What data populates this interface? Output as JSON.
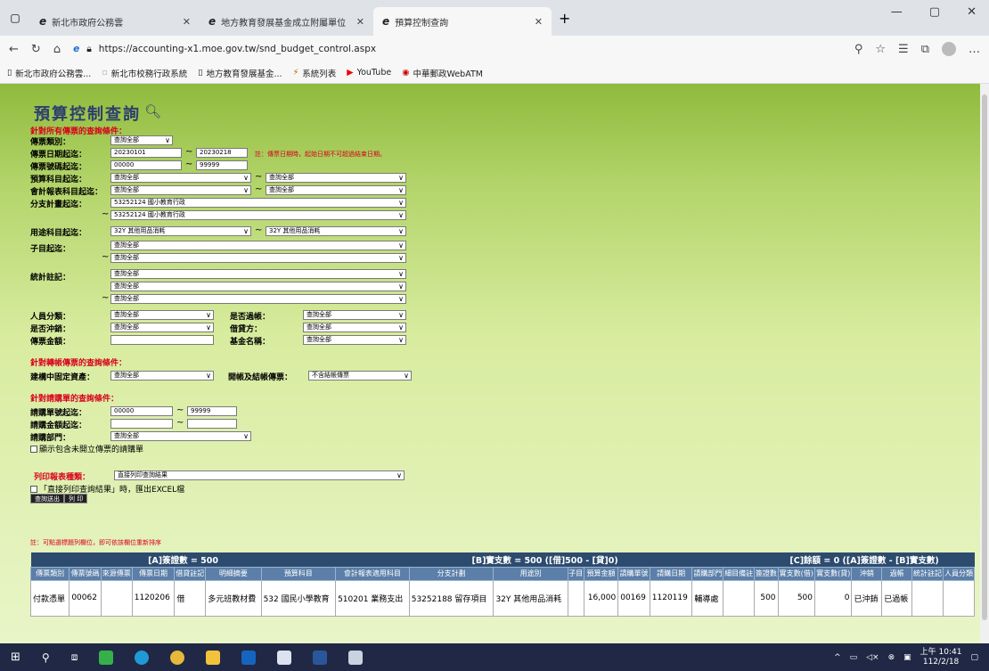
{
  "tabs": [
    {
      "title": "新北市政府公務雲"
    },
    {
      "title": "地方教育發展基金成立附屬單位"
    },
    {
      "title": "預算控制查詢"
    }
  ],
  "address": {
    "url": "https://accounting-x1.moe.gov.tw/snd_budget_control.aspx"
  },
  "bookmarks": [
    "新北市政府公務雲...",
    "新北市校務行政系統",
    "地方教育發展基金...",
    "系統列表",
    "YouTube",
    "中華郵政WebATM"
  ],
  "page": {
    "title": "預算控制查詢",
    "sec1": "針對所有傳票的查詢條件：",
    "sec2": "針對轉帳傳票的查詢條件：",
    "sec3": "針對請購單的查詢條件：",
    "labels": {
      "voucher_type": "傳票類別：",
      "voucher_date": "傳票日期起迄：",
      "voucher_no": "傳票號碼起迄：",
      "budget_item": "預算科目起迄：",
      "acct_item": "會計報表科目起迄：",
      "branch_plan": "分支計畫起迄：",
      "usage_item": "用途科目起迄：",
      "sub_item": "子目起迄：",
      "stat_note": "統計註記：",
      "person_cat": "人員分類：",
      "is_closed": "是否過帳：",
      "is_offset": "是否沖銷：",
      "dc_side": "借貸方：",
      "voucher_amt": "傳票金額：",
      "fund_name": "基金名稱：",
      "fixed_asset": "建構中固定資產：",
      "open_close": "開帳及結帳傳票：",
      "req_no": "請購單號起迄：",
      "req_amt": "請購金額起迄：",
      "req_dept": "請購部門：",
      "report_type": "列印報表種類："
    },
    "date_note": "註：傳票日期時，起始日期不可超過結束日期。",
    "values": {
      "voucher_type": "查詢全部",
      "date_from": "20230101",
      "date_to": "20230218",
      "no_from": "00000",
      "no_to": "99999",
      "all": "查詢全部",
      "branch": "53252124 國小教育行政",
      "usage": "32Y 其他用品消耗",
      "open_close": "不含結帳傳票",
      "req_from": "00000",
      "req_to": "99999",
      "report": "直接列印查詢結果"
    },
    "chk_unissued": "顯示包含未開立傳票的請購單",
    "chk_excel": "「直接列印查詢結果」時，匯出EXCEL檔",
    "btn_query": "查詢送出",
    "btn_print": "列 印",
    "sort_note": "註：可點選標題列欄位，即可依該欄位重新排序"
  },
  "results": {
    "sum_a": "[A]簽證數 = 500",
    "sum_b": "[B]實支數 = 500 ([借]500 - [貸]0)",
    "sum_c": "[C]餘額 = 0 ([A]簽證數 - [B]實支數)",
    "columns": [
      "傳票類別",
      "傳票號碼",
      "來源傳票",
      "傳票日期",
      "借貸註記",
      "明細摘要",
      "預算科目",
      "會計報表適用科目",
      "分支計劃",
      "用途別",
      "子目",
      "預算金額",
      "請購單號",
      "請購日期",
      "請購部門",
      "細目備註",
      "簽證數",
      "實支數(借)",
      "實支數(貸)",
      "沖銷",
      "過帳",
      "統計註記",
      "人員分類"
    ],
    "row": [
      "付款憑單",
      "00062",
      "",
      "1120206",
      "借",
      "多元班教材費",
      "532 國民小學教育",
      "510201 業務支出",
      "53252188 留存項目",
      "32Y 其他用品消耗",
      "",
      "16,000",
      "00169",
      "1120119",
      "輔導處",
      "",
      "500",
      "500",
      "0",
      "已沖銷",
      "已過帳",
      "",
      ""
    ]
  },
  "taskbar": {
    "time": "上午 10:41",
    "date": "112/2/18"
  }
}
